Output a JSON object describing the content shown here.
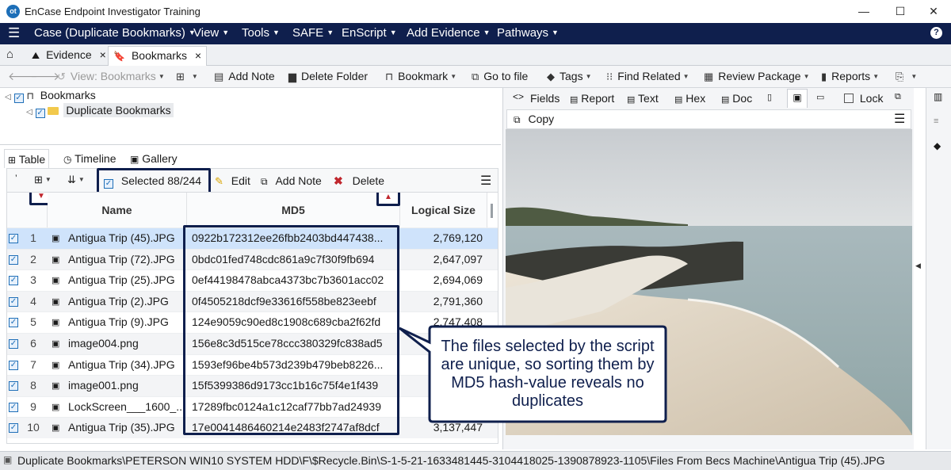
{
  "window": {
    "logo_text": "ot",
    "title": "EnCase Endpoint Investigator Training",
    "minimize": "—",
    "maximize": "☐",
    "close": "✕"
  },
  "menu": {
    "hamburger": "☰",
    "items": [
      {
        "label": "Case (Duplicate Bookmarks)"
      },
      {
        "label": "View"
      },
      {
        "label": "Tools"
      },
      {
        "label": "SAFE"
      },
      {
        "label": "EnScript"
      },
      {
        "label": "Add Evidence"
      },
      {
        "label": "Pathways"
      }
    ],
    "help": "?"
  },
  "tabs": [
    {
      "label": "Evidence",
      "close": "×"
    },
    {
      "label": "Bookmarks",
      "close": "×"
    }
  ],
  "toolbar": {
    "view": "View: Bookmarks",
    "add_note": "Add Note",
    "delete_folder": "Delete Folder",
    "bookmark": "Bookmark",
    "go_to_file": "Go to file",
    "tags": "Tags",
    "find_related": "Find Related",
    "review_package": "Review Package",
    "reports": "Reports"
  },
  "tree": {
    "root": "Bookmarks",
    "child": "Duplicate Bookmarks"
  },
  "view_tabs": [
    "Table",
    "Timeline",
    "Gallery"
  ],
  "table_toolbar": {
    "selected": "Selected 88/244",
    "edit": "Edit",
    "add_note": "Add Note",
    "delete": "Delete"
  },
  "columns": {
    "name": "Name",
    "md5": "MD5",
    "logical_size": "Logical Size"
  },
  "rows": [
    {
      "num": "1",
      "name": "Antigua Trip (45).JPG",
      "md5": "0922b172312ee26fbb2403bd447438...",
      "size": "2,769,120"
    },
    {
      "num": "2",
      "name": "Antigua Trip (72).JPG",
      "md5": "0bdc01fed748cdc861a9c7f30f9fb694",
      "size": "2,647,097"
    },
    {
      "num": "3",
      "name": "Antigua Trip (25).JPG",
      "md5": "0ef44198478abca4373bc7b3601acc02",
      "size": "2,694,069"
    },
    {
      "num": "4",
      "name": "Antigua Trip (2).JPG",
      "md5": "0f4505218dcf9e33616f558be823eebf",
      "size": "2,791,360"
    },
    {
      "num": "5",
      "name": "Antigua Trip (9).JPG",
      "md5": "124e9059c90ed8c1908c689cba2f62fd",
      "size": "2,747,408"
    },
    {
      "num": "6",
      "name": "image004.png",
      "md5": "156e8c3d515ce78ccc380329fc838ad5",
      "size": ""
    },
    {
      "num": "7",
      "name": "Antigua Trip (34).JPG",
      "md5": "1593ef96be4b573d239b479beb8226...",
      "size": ""
    },
    {
      "num": "8",
      "name": "image001.png",
      "md5": "15f5399386d9173cc1b16c75f4e1f439",
      "size": ""
    },
    {
      "num": "9",
      "name": "LockScreen___1600_...",
      "md5": "17289fbc0124a1c12caf77bb7ad24939",
      "size": ""
    },
    {
      "num": "10",
      "name": "Antigua Trip (35).JPG",
      "md5": "17e0041486460214e2483f2747af8dcf",
      "size": "3,137,447"
    }
  ],
  "viewer": {
    "tabs": [
      "Fields",
      "Report",
      "Text",
      "Hex",
      "Doc",
      "Lock"
    ],
    "copy": "Copy"
  },
  "callout": "The files selected by the script are unique, so sorting them by MD5 hash-value reveals no duplicates",
  "status": "Duplicate Bookmarks\\PETERSON WIN10 SYSTEM HDD\\F\\$Recycle.Bin\\S-1-5-21-1633481445-3104418025-1390878923-1105\\Files From Becs Machine\\Antigua Trip (45).JPG",
  "colors": {
    "menu_bg": "#0f1f4d",
    "highlight": "#0f1f4d",
    "selection": "#cfe3fb",
    "check": "#1f6fb8"
  }
}
